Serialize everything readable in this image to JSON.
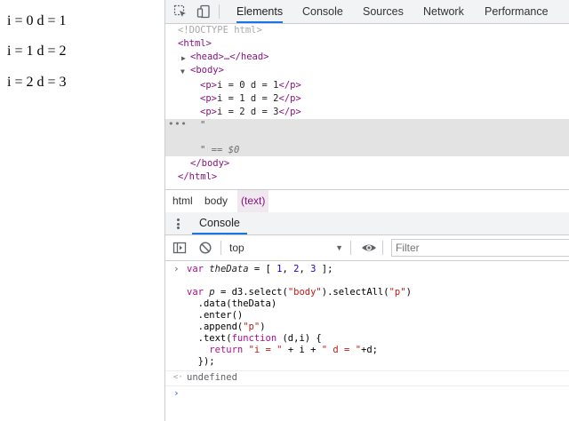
{
  "page": {
    "paragraphs": [
      "i = 0 d = 1",
      "i = 1 d = 2",
      "i = 2 d = 3"
    ]
  },
  "devtools": {
    "tabs": [
      "Elements",
      "Console",
      "Sources",
      "Network",
      "Performance"
    ],
    "active_tab": "Elements",
    "dom": {
      "doctype": "<!DOCTYPE html>",
      "html_open": "<html>",
      "head_collapsed": "<head>…</head>",
      "body_open": "<body>",
      "p_lines": [
        {
          "open": "<p>",
          "text": "i = 0 d = 1",
          "close": "</p>"
        },
        {
          "open": "<p>",
          "text": "i = 1 d = 2",
          "close": "</p>"
        },
        {
          "open": "<p>",
          "text": "i = 2 d = 3",
          "close": "</p>"
        }
      ],
      "text_node_open": "\"",
      "text_node_close": "\"",
      "text_node_ref": "== $0",
      "body_close": "</body>",
      "html_close": "</html>"
    },
    "breadcrumb": [
      "html",
      "body",
      "(text)"
    ],
    "drawer": {
      "tab": "Console"
    },
    "console_toolbar": {
      "context": "top",
      "filter_placeholder": "Filter"
    },
    "console": {
      "input_lines": [
        "var theData = [ 1, 2, 3 ];",
        "",
        "var p = d3.select(\"body\").selectAll(\"p\")",
        "  .data(theData)",
        "  .enter()",
        "  .append(\"p\")",
        "  .text(function (d,i) {",
        "    return \"i = \" + i + \" d = \"+d;",
        "  });"
      ],
      "result": "undefined"
    }
  }
}
